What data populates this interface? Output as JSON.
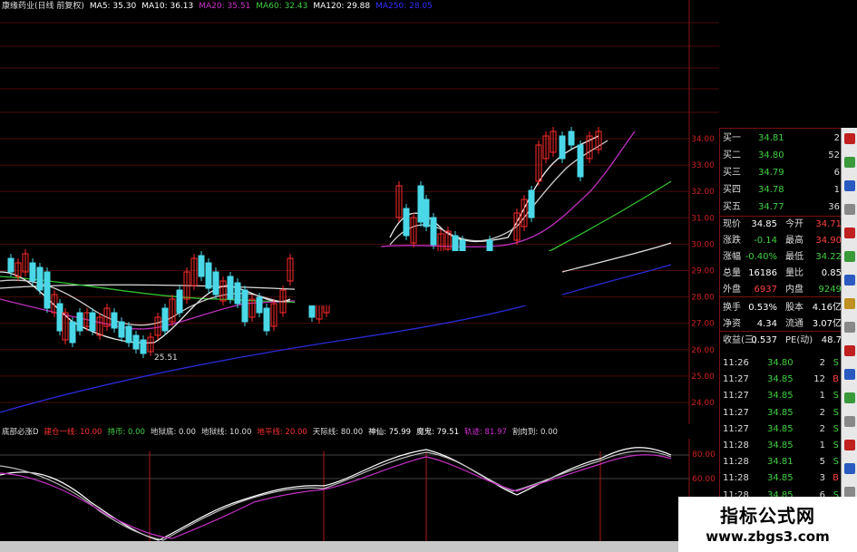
{
  "header": {
    "stock": "康缘药业(日线 前复权)",
    "ma": [
      {
        "label": "MA5: 35.30",
        "color": "#ffffff"
      },
      {
        "label": "MA10: 36.13",
        "color": "#ffffff"
      },
      {
        "label": "MA20: 35.51",
        "color": "#d030d0"
      },
      {
        "label": "MA60: 32.43",
        "color": "#40d040"
      },
      {
        "label": "MA120: 29.88",
        "color": "#ffffff"
      },
      {
        "label": "MA250: 28.05",
        "color": "#3030ff"
      }
    ]
  },
  "price_axis": [
    "34.00",
    "33.00",
    "32.00",
    "31.00",
    "30.00",
    "29.00",
    "28.00",
    "27.00",
    "26.00",
    "25.00",
    "24.00"
  ],
  "low_label": "25.51",
  "indicator": {
    "items": [
      {
        "label": "底部必涨D",
        "color": "#dddddd"
      },
      {
        "label": "建仓一线: 10.00",
        "color": "#ff3030"
      },
      {
        "label": "持币: 0.00",
        "color": "#40d040"
      },
      {
        "label": "地狱底: 0.00",
        "color": "#dddddd"
      },
      {
        "label": "地狱线: 10.00",
        "color": "#dddddd"
      },
      {
        "label": "地平线: 20.00",
        "color": "#ff3030"
      },
      {
        "label": "天际线: 80.00",
        "color": "#dddddd"
      },
      {
        "label": "神仙: 75.99",
        "color": "#ffffff"
      },
      {
        "label": "魔鬼: 79.51",
        "color": "#ffffff"
      },
      {
        "label": "轨迹: 81.97",
        "color": "#d030d0"
      },
      {
        "label": "割肉到: 0.00",
        "color": "#dddddd"
      }
    ],
    "axis": [
      "80.00",
      "60.00"
    ]
  },
  "order_book": [
    {
      "label": "买一",
      "price": "34.81",
      "vol": "2"
    },
    {
      "label": "买二",
      "price": "34.80",
      "vol": "52"
    },
    {
      "label": "买三",
      "price": "34.79",
      "vol": "6"
    },
    {
      "label": "买四",
      "price": "34.78",
      "vol": "1"
    },
    {
      "label": "买五",
      "price": "34.77",
      "vol": "36"
    }
  ],
  "quote": [
    {
      "l1": "现价",
      "v1": "34.85",
      "v1c": "#ffffff",
      "l2": "今开",
      "v2": "34.71",
      "v2c": "#ff4040"
    },
    {
      "l1": "涨跌",
      "v1": "-0.14",
      "v1c": "#40d040",
      "l2": "最高",
      "v2": "34.90",
      "v2c": "#ff4040"
    },
    {
      "l1": "涨幅",
      "v1": "-0.40%",
      "v1c": "#40d040",
      "l2": "最低",
      "v2": "34.22",
      "v2c": "#40d040"
    },
    {
      "l1": "总量",
      "v1": "16186",
      "v1c": "#ffffff",
      "l2": "量比",
      "v2": "0.85",
      "v2c": "#ffffff"
    },
    {
      "l1": "外盘",
      "v1": "6937",
      "v1c": "#ff4040",
      "l2": "内盘",
      "v2": "9249",
      "v2c": "#40d040"
    },
    {
      "l1": "换手",
      "v1": "0.53%",
      "v1c": "#ffffff",
      "l2": "股本",
      "v2": "4.16亿",
      "v2c": "#ffffff"
    },
    {
      "l1": "净资",
      "v1": "4.34",
      "v1c": "#ffffff",
      "l2": "流通",
      "v2": "3.07亿",
      "v2c": "#ffffff"
    },
    {
      "l1": "收益(三)",
      "v1": "0.537",
      "v1c": "#ffffff",
      "l2": "PE(动)",
      "v2": "48.7",
      "v2c": "#ffffff"
    }
  ],
  "ticks": [
    {
      "time": "11:26",
      "price": "34.80",
      "vol": "2",
      "side": "S"
    },
    {
      "time": "11:27",
      "price": "34.85",
      "vol": "12",
      "side": "B"
    },
    {
      "time": "11:27",
      "price": "34.85",
      "vol": "1",
      "side": "S"
    },
    {
      "time": "11:27",
      "price": "34.85",
      "vol": "2",
      "side": "S"
    },
    {
      "time": "11:27",
      "price": "34.85",
      "vol": "2",
      "side": "S"
    },
    {
      "time": "11:28",
      "price": "34.85",
      "vol": "1",
      "side": "S"
    },
    {
      "time": "11:28",
      "price": "34.81",
      "vol": "5",
      "side": "S"
    },
    {
      "time": "11:28",
      "price": "34.85",
      "vol": "3",
      "side": "B"
    },
    {
      "time": "11:28",
      "price": "34.85",
      "vol": "6",
      "side": "S"
    }
  ],
  "watermark": {
    "title": "指标公式网",
    "url": "www.zbgs3.com"
  }
}
